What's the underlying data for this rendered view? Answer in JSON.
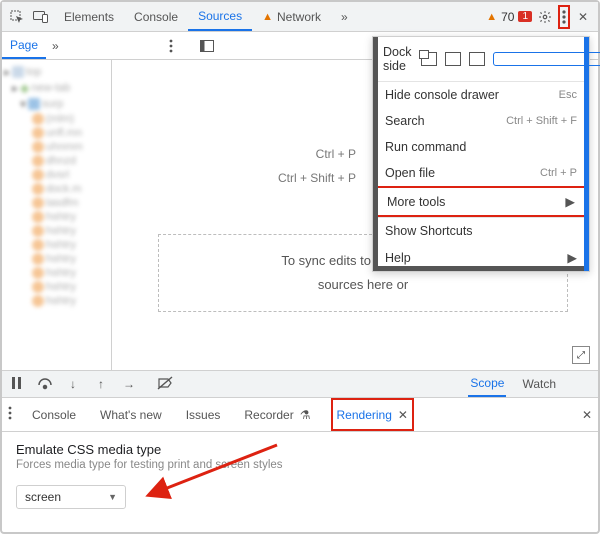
{
  "topTabs": {
    "elements": "Elements",
    "console": "Console",
    "sources": "Sources",
    "network": "Network"
  },
  "warnings_count": "70",
  "errors_count": "1",
  "dock_label": "Dock side",
  "menu": {
    "hide": "Hide console drawer",
    "hide_kb": "Esc",
    "search": "Search",
    "search_kb": "Ctrl + Shift + F",
    "run": "Run command",
    "open": "Open file",
    "open_kb": "Ctrl + P",
    "more": "More tools",
    "shortcuts": "Show Shortcuts",
    "help": "Help"
  },
  "page_tab": "Page",
  "editor_shortcuts": {
    "open": "Ctrl + P",
    "run": "Ctrl + Shift + P"
  },
  "sync_line1": "To sync edits to the workspa",
  "sync_line2": "sources here or",
  "dbg_tabs": {
    "scope": "Scope",
    "watch": "Watch"
  },
  "drawer": {
    "console": "Console",
    "whatsnew": "What's new",
    "issues": "Issues",
    "recorder": "Recorder",
    "rendering": "Rendering"
  },
  "rendering": {
    "title": "Emulate CSS media type",
    "sub": "Forces media type for testing print and screen styles",
    "value": "screen"
  },
  "tree": [
    "top",
    "new-tab",
    "surp",
    "(mlm)",
    "unfl.mn",
    "uhnmm",
    "dhnzd",
    "dvsrl",
    "dock.m",
    "lasdfm",
    "hshtry",
    "hshtry",
    "hshtry",
    "hshtry",
    "hshtry",
    "hshtry",
    "hshtry"
  ]
}
